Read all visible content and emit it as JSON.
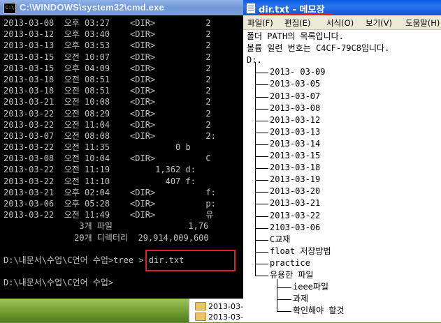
{
  "cmd": {
    "title": "C:\\WINDOWS\\system32\\cmd.exe",
    "icon_text": "C:\\",
    "lines": [
      "2013-03-08  오후 03:27    <DIR>          2",
      "2013-03-12  오후 03:40    <DIR>          2",
      "2013-03-13  오후 03:53    <DIR>          2",
      "2013-03-15  오전 10:07    <DIR>          2",
      "2013-03-15  오후 04:09    <DIR>          2",
      "2013-03-18  오전 08:51    <DIR>          2",
      "2013-03-18  오전 08:51    <DIR>          2",
      "2013-03-21  오전 10:08    <DIR>          2",
      "2013-03-22  오전 08:29    <DIR>          2",
      "2013-03-22  오전 11:04    <DIR>          2",
      "2013-03-07  오전 08:08    <DIR>          2:",
      "2013-03-22  오전 11:35             0 b",
      "2013-03-08  오전 10:04    <DIR>          C",
      "2013-03-22  오전 11:19         1,362 d:",
      "2013-03-22  오전 11:10           407 f:",
      "2013-03-21  오후 02:04    <DIR>          f:",
      "2013-03-06  오후 05:28    <DIR>          p:",
      "2013-03-22  오전 11:49    <DIR>          유",
      "               3개 파일               1,76",
      "              20개 디렉터리  29,914,009,600",
      "",
      "D:\\내문서\\수업\\C언어 수업>tree > dir.txt",
      "",
      "D:\\내문서\\수업\\C언어 수업>"
    ]
  },
  "notepad": {
    "title": "dir.txt - 메모장",
    "menu": [
      "파일(F)",
      "편집(E)",
      "서식(O)",
      "보기(V)",
      "도움말(H)"
    ],
    "header_lines": [
      "폴더 PATH의 목록입니다.",
      "볼륨 일련 번호는 C4CF-79C8입니다.",
      "D:."
    ],
    "tree_items": [
      "2013- 03-09",
      "2013-03-05",
      "2013-03-07",
      "2013-03-08",
      "2013-03-12",
      "2013-03-13",
      "2013-03-14",
      "2013-03-15",
      "2013-03-18",
      "2013-03-19",
      "2013-03-20",
      "2013-03-21",
      "2013-03-22",
      "2103-03-06",
      "C교재",
      "float 저장방법",
      "practice",
      "유용한 파일"
    ],
    "sub_items": [
      "ieee파일",
      "과제",
      "확인해야 할것"
    ]
  },
  "explorer": {
    "items": [
      "2013-03-",
      "2013-03-"
    ]
  }
}
